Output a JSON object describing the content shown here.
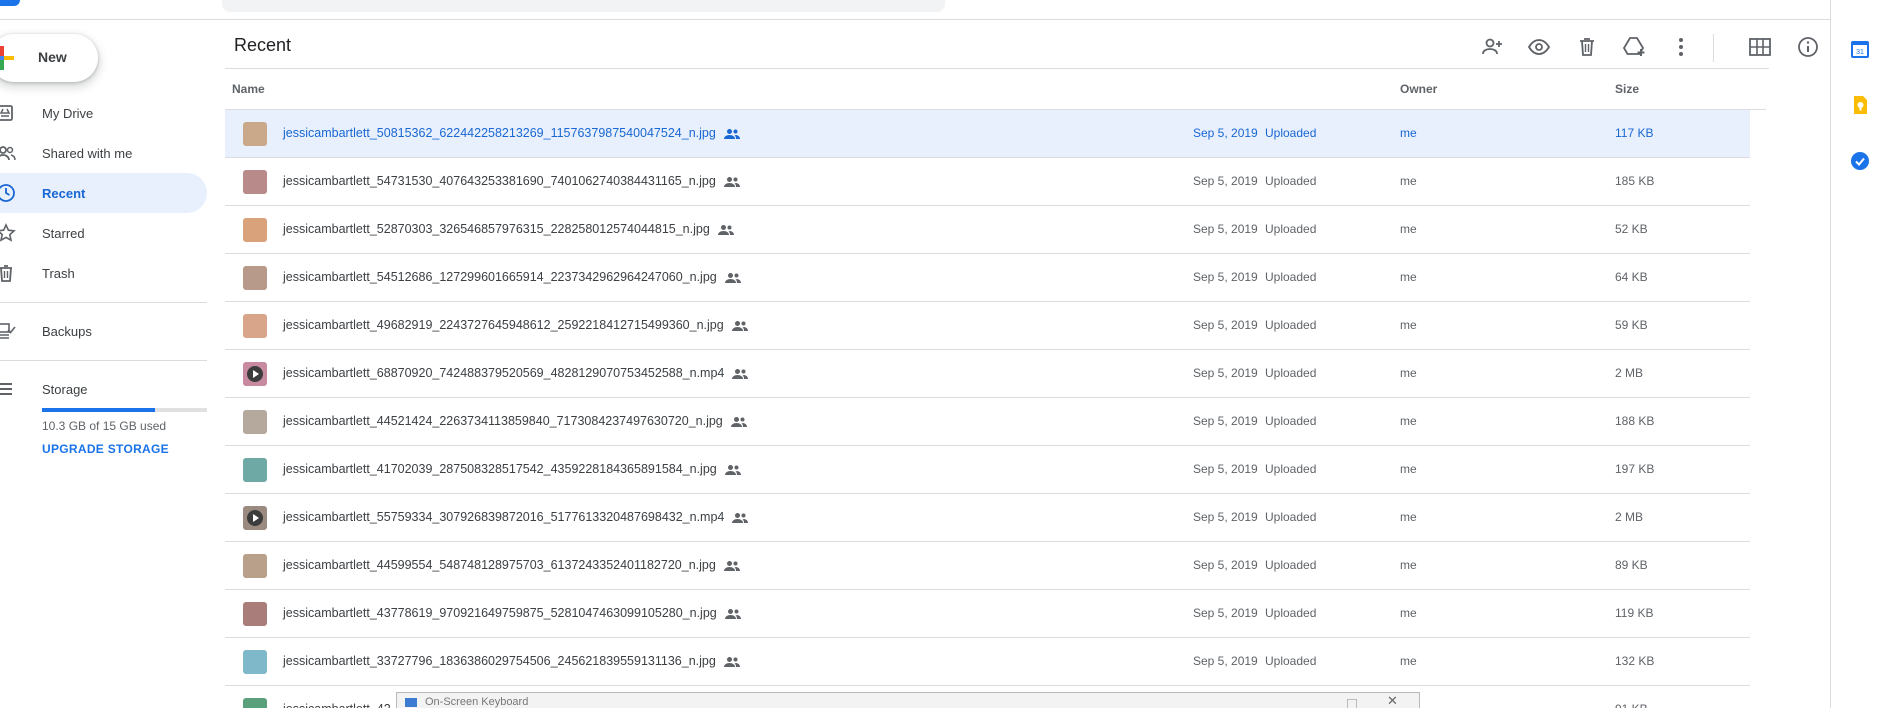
{
  "sidebar": {
    "new_label": "New",
    "items": [
      {
        "label": "My Drive",
        "icon": "my-drive-icon"
      },
      {
        "label": "Shared with me",
        "icon": "shared-with-me-icon"
      },
      {
        "label": "Recent",
        "icon": "recent-clock-icon",
        "active": true
      },
      {
        "label": "Starred",
        "icon": "star-icon"
      },
      {
        "label": "Trash",
        "icon": "trash-icon"
      },
      {
        "label": "Backups",
        "icon": "backups-icon"
      }
    ],
    "storage_label": "Storage",
    "storage_used": "10.3 GB of 15 GB used",
    "storage_fraction": 0.687,
    "upgrade_label": "UPGRADE STORAGE"
  },
  "main": {
    "title": "Recent",
    "toolbar": [
      "share-add-person-icon",
      "preview-eye-icon",
      "delete-trash-icon",
      "add-to-drive-icon",
      "more-vert-icon",
      "grid-view-icon",
      "info-icon"
    ],
    "columns": {
      "name": "Name",
      "owner": "Owner",
      "size": "Size"
    },
    "files": [
      {
        "name": "jessicambartlett_50815362_622442258213269_1157637987540047524_n.jpg",
        "date": "Sep 5, 2019",
        "action": "Uploaded",
        "owner": "me",
        "size": "117 KB",
        "selected": true,
        "thumb": "#c9a98a"
      },
      {
        "name": "jessicambartlett_54731530_407643253381690_7401062740384431165_n.jpg",
        "date": "Sep 5, 2019",
        "action": "Uploaded",
        "owner": "me",
        "size": "185 KB",
        "thumb": "#b88a8a"
      },
      {
        "name": "jessicambartlett_52870303_326546857976315_228258012574044815_n.jpg",
        "date": "Sep 5, 2019",
        "action": "Uploaded",
        "owner": "me",
        "size": "52 KB",
        "thumb": "#d9a27a"
      },
      {
        "name": "jessicambartlett_54512686_127299601665914_2237342962964247060_n.jpg",
        "date": "Sep 5, 2019",
        "action": "Uploaded",
        "owner": "me",
        "size": "64 KB",
        "thumb": "#b89a8a"
      },
      {
        "name": "jessicambartlett_49682919_2243727645948612_2592218412715499360_n.jpg",
        "date": "Sep 5, 2019",
        "action": "Uploaded",
        "owner": "me",
        "size": "59 KB",
        "thumb": "#d8a58a"
      },
      {
        "name": "jessicambartlett_68870920_742488379520569_4828129070753452588_n.mp4",
        "date": "Sep 5, 2019",
        "action": "Uploaded",
        "owner": "me",
        "size": "2 MB",
        "video": true,
        "thumb": "#c78aa0"
      },
      {
        "name": "jessicambartlett_44521424_2263734113859840_7173084237497630720_n.jpg",
        "date": "Sep 5, 2019",
        "action": "Uploaded",
        "owner": "me",
        "size": "188 KB",
        "thumb": "#b5a99e"
      },
      {
        "name": "jessicambartlett_41702039_287508328517542_4359228184365891584_n.jpg",
        "date": "Sep 5, 2019",
        "action": "Uploaded",
        "owner": "me",
        "size": "197 KB",
        "thumb": "#6fa9a5"
      },
      {
        "name": "jessicambartlett_55759334_307926839872016_5177613320487698432_n.mp4",
        "date": "Sep 5, 2019",
        "action": "Uploaded",
        "owner": "me",
        "size": "2 MB",
        "video": true,
        "thumb": "#9a8a80"
      },
      {
        "name": "jessicambartlett_44599554_548748128975703_6137243352401182720_n.jpg",
        "date": "Sep 5, 2019",
        "action": "Uploaded",
        "owner": "me",
        "size": "89 KB",
        "thumb": "#b9a08a"
      },
      {
        "name": "jessicambartlett_43778619_970921649759875_5281047463099105280_n.jpg",
        "date": "Sep 5, 2019",
        "action": "Uploaded",
        "owner": "me",
        "size": "119 KB",
        "thumb": "#a87d7a"
      },
      {
        "name": "jessicambartlett_33727796_1836386029754506_245621839559131136_n.jpg",
        "date": "Sep 5, 2019",
        "action": "Uploaded",
        "owner": "me",
        "size": "132 KB",
        "thumb": "#7fb9c9"
      },
      {
        "name": "jessicambartlett_42",
        "date": "",
        "action": "",
        "owner": "",
        "size": "91 KB",
        "thumb": "#5aa07a"
      }
    ]
  },
  "side_panel": [
    "calendar-icon",
    "keep-icon",
    "tasks-icon"
  ],
  "osk_title": "On-Screen Keyboard"
}
